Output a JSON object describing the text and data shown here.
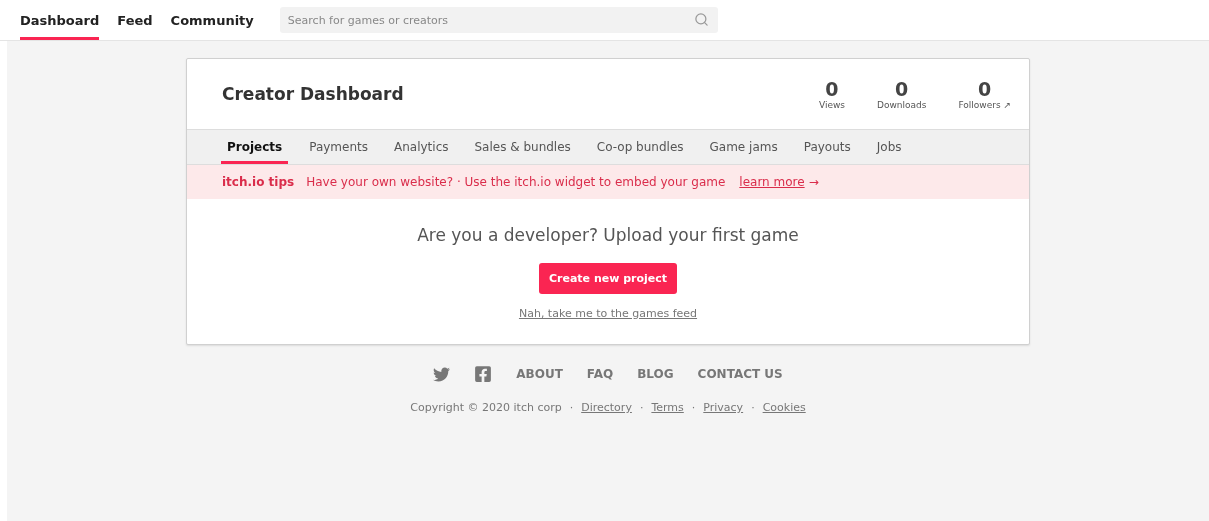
{
  "nav": {
    "items": [
      {
        "label": "Dashboard",
        "selected": true
      },
      {
        "label": "Feed",
        "selected": false
      },
      {
        "label": "Community",
        "selected": false
      }
    ],
    "search": {
      "placeholder": "Search for games or creators"
    }
  },
  "dashboard": {
    "title": "Creator Dashboard",
    "stats": [
      {
        "value": "0",
        "label": "Views"
      },
      {
        "value": "0",
        "label": "Downloads"
      },
      {
        "value": "0",
        "label": "Followers",
        "suffix": "↗"
      }
    ],
    "tabs": [
      {
        "label": "Projects",
        "selected": true
      },
      {
        "label": "Payments",
        "selected": false
      },
      {
        "label": "Analytics",
        "selected": false
      },
      {
        "label": "Sales & bundles",
        "selected": false
      },
      {
        "label": "Co-op bundles",
        "selected": false
      },
      {
        "label": "Game jams",
        "selected": false
      },
      {
        "label": "Payouts",
        "selected": false
      },
      {
        "label": "Jobs",
        "selected": false
      }
    ],
    "tip": {
      "heading": "itch.io tips",
      "text": "Have your own website? · Use the itch.io widget to embed your game",
      "link": "learn more",
      "arrow": "→"
    },
    "empty": {
      "heading": "Are you a developer? Upload your first game",
      "button": "Create new project",
      "link": "Nah, take me to the games feed"
    }
  },
  "footer": {
    "social": [
      {
        "kind": "twitter"
      },
      {
        "kind": "facebook"
      }
    ],
    "links": [
      "ABOUT",
      "FAQ",
      "BLOG",
      "CONTACT US"
    ],
    "legal": [
      {
        "kind": "text",
        "label": "Copyright © 2020 itch corp"
      },
      {
        "kind": "sep",
        "label": "·"
      },
      {
        "kind": "link",
        "label": "Directory"
      },
      {
        "kind": "sep",
        "label": "·"
      },
      {
        "kind": "link",
        "label": "Terms"
      },
      {
        "kind": "sep",
        "label": "·"
      },
      {
        "kind": "link",
        "label": "Privacy"
      },
      {
        "kind": "sep",
        "label": "·"
      },
      {
        "kind": "link",
        "label": "Cookies"
      }
    ]
  }
}
